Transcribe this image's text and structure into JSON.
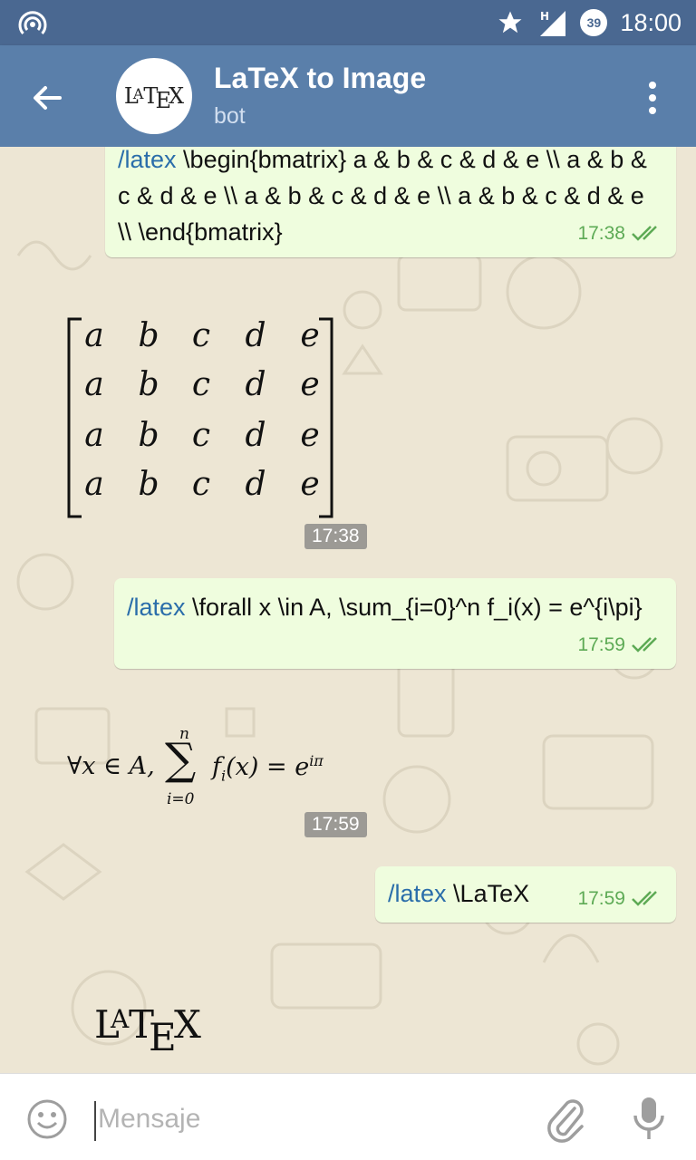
{
  "status_bar": {
    "time": "18:00",
    "battery": "39",
    "network": "H"
  },
  "header": {
    "title": "LaTeX to Image",
    "subtitle": "bot",
    "avatar_text": "LaTeX"
  },
  "messages": [
    {
      "kind": "out",
      "command": "/latex",
      "text": " \\begin{bmatrix} a & b & c & d & e \\\\ a & b & c & d & e \\\\ a & b & c & d & e \\\\ a & b & c & d & e \\\\ \\end{bmatrix}",
      "time": "17:38"
    },
    {
      "kind": "image",
      "content": "matrix",
      "time": "17:38"
    },
    {
      "kind": "out",
      "command": "/latex",
      "text": " \\forall x \\in A, \\sum_{i=0}^n f_i(x) = e^{i\\pi}",
      "time": "17:59"
    },
    {
      "kind": "image",
      "content": "formula",
      "time": "17:59"
    },
    {
      "kind": "out",
      "command": "/latex",
      "text": " \\LaTeX",
      "time": "17:59"
    },
    {
      "kind": "image",
      "content": "latex-logo",
      "time": ""
    }
  ],
  "matrix": {
    "rows": [
      [
        "a",
        "b",
        "c",
        "d",
        "e"
      ],
      [
        "a",
        "b",
        "c",
        "d",
        "e"
      ],
      [
        "a",
        "b",
        "c",
        "d",
        "e"
      ],
      [
        "a",
        "b",
        "c",
        "d",
        "e"
      ]
    ]
  },
  "formula": {
    "forall": "∀x ∈ A,",
    "sum": "∑",
    "upper": "n",
    "lower": "i=0",
    "rhs": "f",
    "rhs_sub": "i",
    "rhs_tail": "(x) = e",
    "rhs_sup": "iπ"
  },
  "logo": {
    "L": "L",
    "A": "A",
    "T": "T",
    "E": "E",
    "X": "X"
  },
  "input": {
    "placeholder": "Mensaje"
  },
  "icons": [
    "hotspot-icon",
    "star-icon",
    "signal-icon",
    "battery-icon",
    "back-arrow-icon",
    "more-vert-icon",
    "double-check-icon",
    "emoji-icon",
    "paperclip-icon",
    "microphone-icon"
  ]
}
